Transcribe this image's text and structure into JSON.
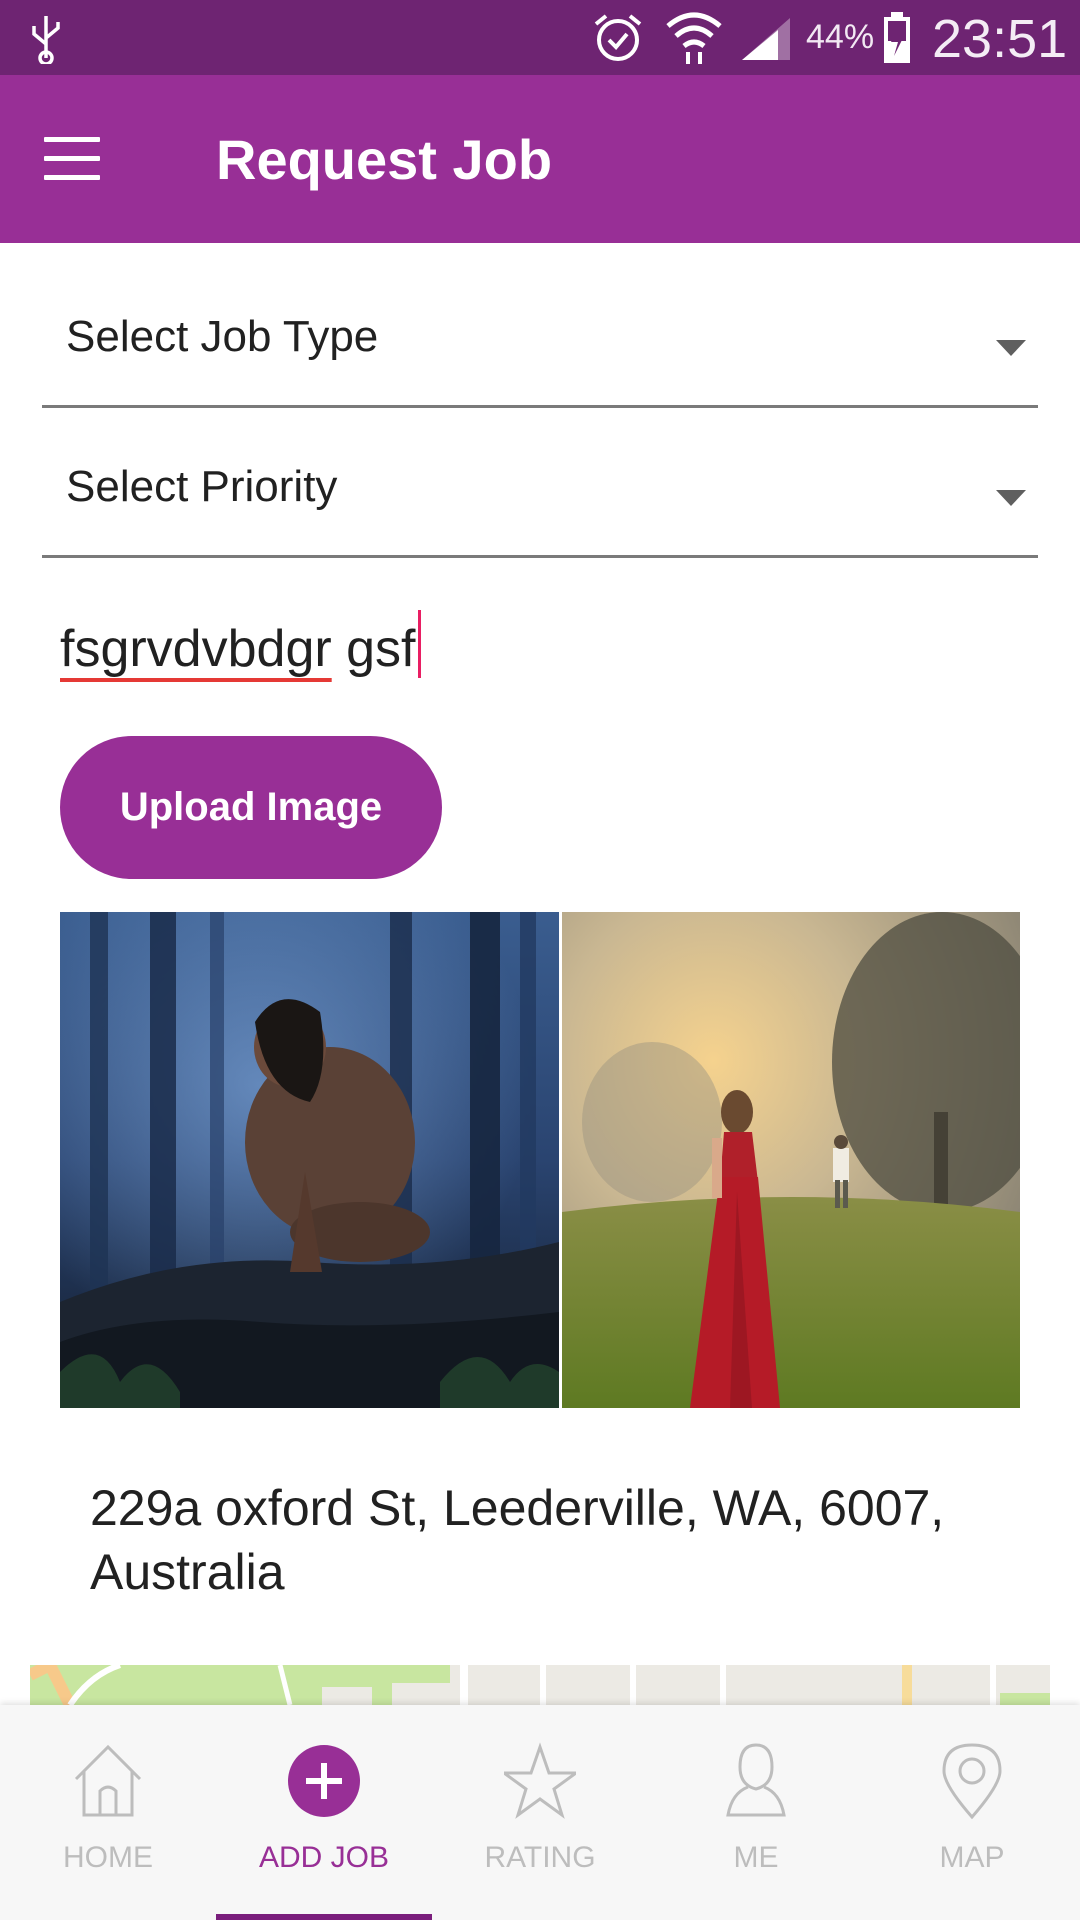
{
  "status_bar": {
    "battery_percent": "44%",
    "time": "23:51",
    "icons": [
      "usb-icon",
      "alarm-icon",
      "wifi-icon",
      "signal-icon",
      "battery-charging-icon"
    ]
  },
  "app_bar": {
    "title": "Request Job",
    "menu_icon": "hamburger-menu-icon"
  },
  "form": {
    "job_type": {
      "label": "Select Job Type"
    },
    "priority": {
      "label": "Select Priority"
    },
    "description": {
      "value_misspelled": "fsgrvdvbdgr",
      "value_rest": " gsf"
    },
    "upload_button": "Upload Image"
  },
  "images": [
    "forest-man-photo",
    "woman-red-dress-foggy-field-photo"
  ],
  "address": "229a oxford St, Leederville, WA, 6007, Australia",
  "bottom_nav": {
    "items": [
      {
        "label": "HOME",
        "icon": "home-icon"
      },
      {
        "label": "ADD JOB",
        "icon": "add-circle-icon"
      },
      {
        "label": "RATING",
        "icon": "star-icon"
      },
      {
        "label": "ME",
        "icon": "person-icon"
      },
      {
        "label": "MAP",
        "icon": "map-pin-icon"
      }
    ],
    "active": "ADD JOB"
  },
  "colors": {
    "status_bar": "#6e2472",
    "primary": "#982f96",
    "accent_cursor": "#e91e63"
  }
}
